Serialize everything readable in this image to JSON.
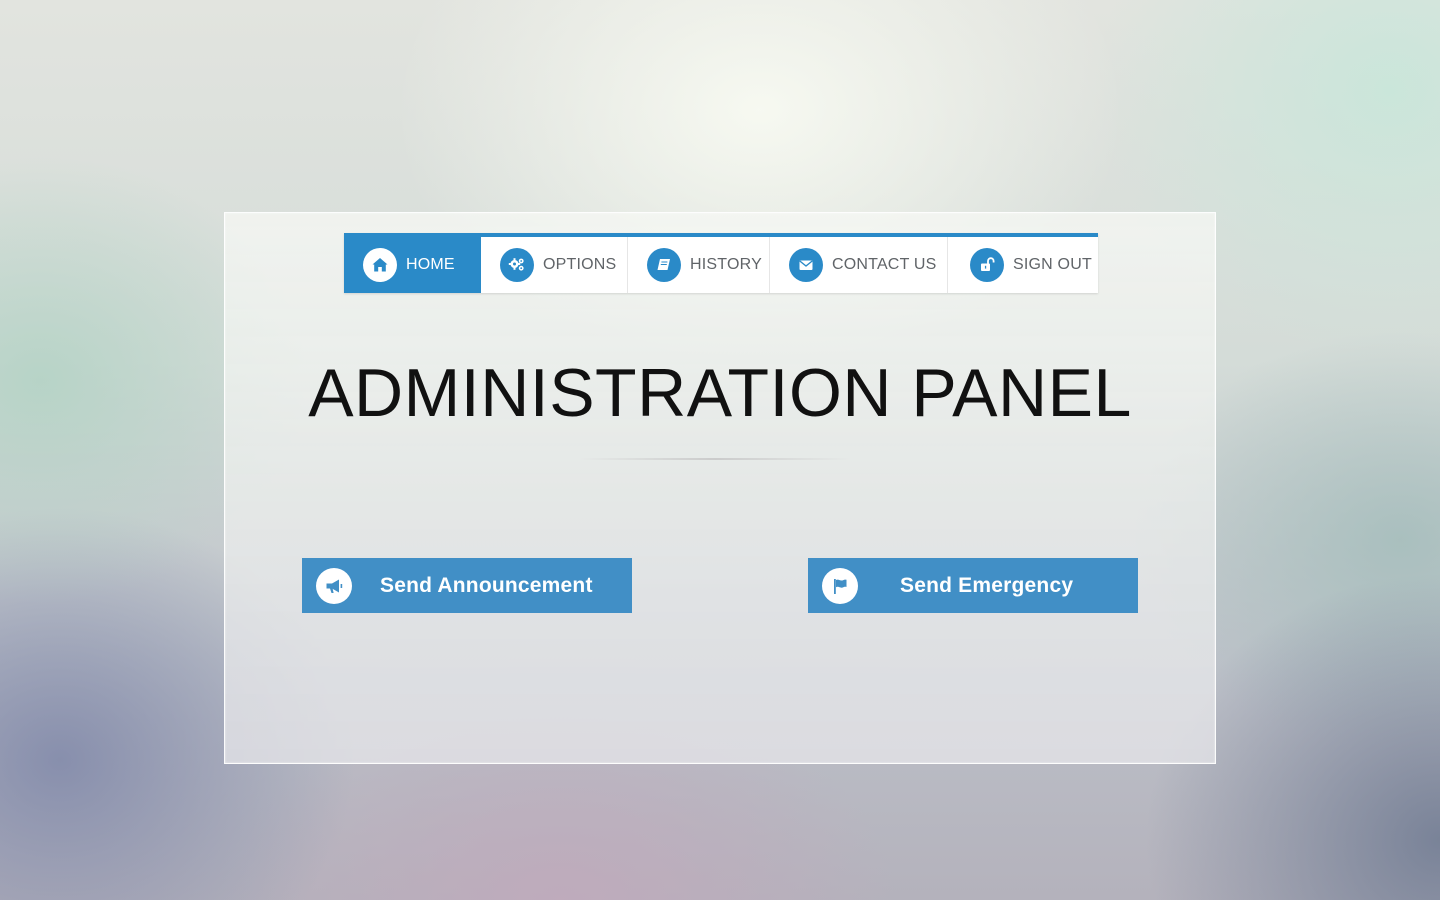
{
  "nav": {
    "items": [
      {
        "label": "HOME",
        "icon": "home-icon",
        "active": true
      },
      {
        "label": "OPTIONS",
        "icon": "gears-icon",
        "active": false
      },
      {
        "label": "HISTORY",
        "icon": "book-icon",
        "active": false
      },
      {
        "label": "CONTACT US",
        "icon": "envelope-icon",
        "active": false
      },
      {
        "label": "SIGN OUT",
        "icon": "unlock-icon",
        "active": false
      }
    ]
  },
  "main": {
    "title": "ADMINISTRATION PANEL"
  },
  "actions": {
    "announcement": {
      "label": "Send Announcement",
      "icon": "megaphone-icon"
    },
    "emergency": {
      "label": "Send Emergency",
      "icon": "flag-icon"
    }
  },
  "colors": {
    "accent": "#2a8ac8",
    "button": "#418fc6",
    "nav_text": "#606468",
    "title_text": "#111111"
  }
}
